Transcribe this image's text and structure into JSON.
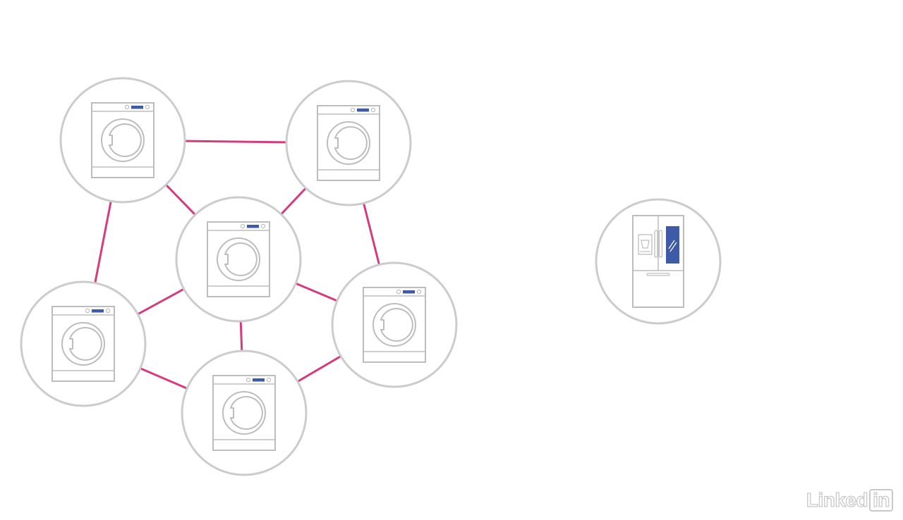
{
  "colors": {
    "background": "#ffffff",
    "node_outline": "#cccccc",
    "appliance_outline": "#bdbdbd",
    "link": "#d63b7f",
    "display_accent": "#3f5aa6"
  },
  "diagram": {
    "nodes": [
      {
        "id": "washer-top-left",
        "icon": "washing-machine-icon"
      },
      {
        "id": "washer-top-right",
        "icon": "washing-machine-icon"
      },
      {
        "id": "washer-center",
        "icon": "washing-machine-icon"
      },
      {
        "id": "washer-mid-left",
        "icon": "washing-machine-icon"
      },
      {
        "id": "washer-mid-right",
        "icon": "washing-machine-icon"
      },
      {
        "id": "washer-bottom",
        "icon": "washing-machine-icon"
      },
      {
        "id": "refrigerator",
        "icon": "refrigerator-icon"
      }
    ],
    "links": [
      [
        "washer-top-left",
        "washer-top-right"
      ],
      [
        "washer-top-left",
        "washer-center"
      ],
      [
        "washer-top-left",
        "washer-mid-left"
      ],
      [
        "washer-top-right",
        "washer-center"
      ],
      [
        "washer-top-right",
        "washer-mid-right"
      ],
      [
        "washer-center",
        "washer-mid-left"
      ],
      [
        "washer-center",
        "washer-mid-right"
      ],
      [
        "washer-center",
        "washer-bottom"
      ],
      [
        "washer-mid-left",
        "washer-bottom"
      ],
      [
        "washer-mid-right",
        "washer-bottom"
      ]
    ]
  },
  "watermark": {
    "word": "Linked",
    "boxed": "in"
  }
}
